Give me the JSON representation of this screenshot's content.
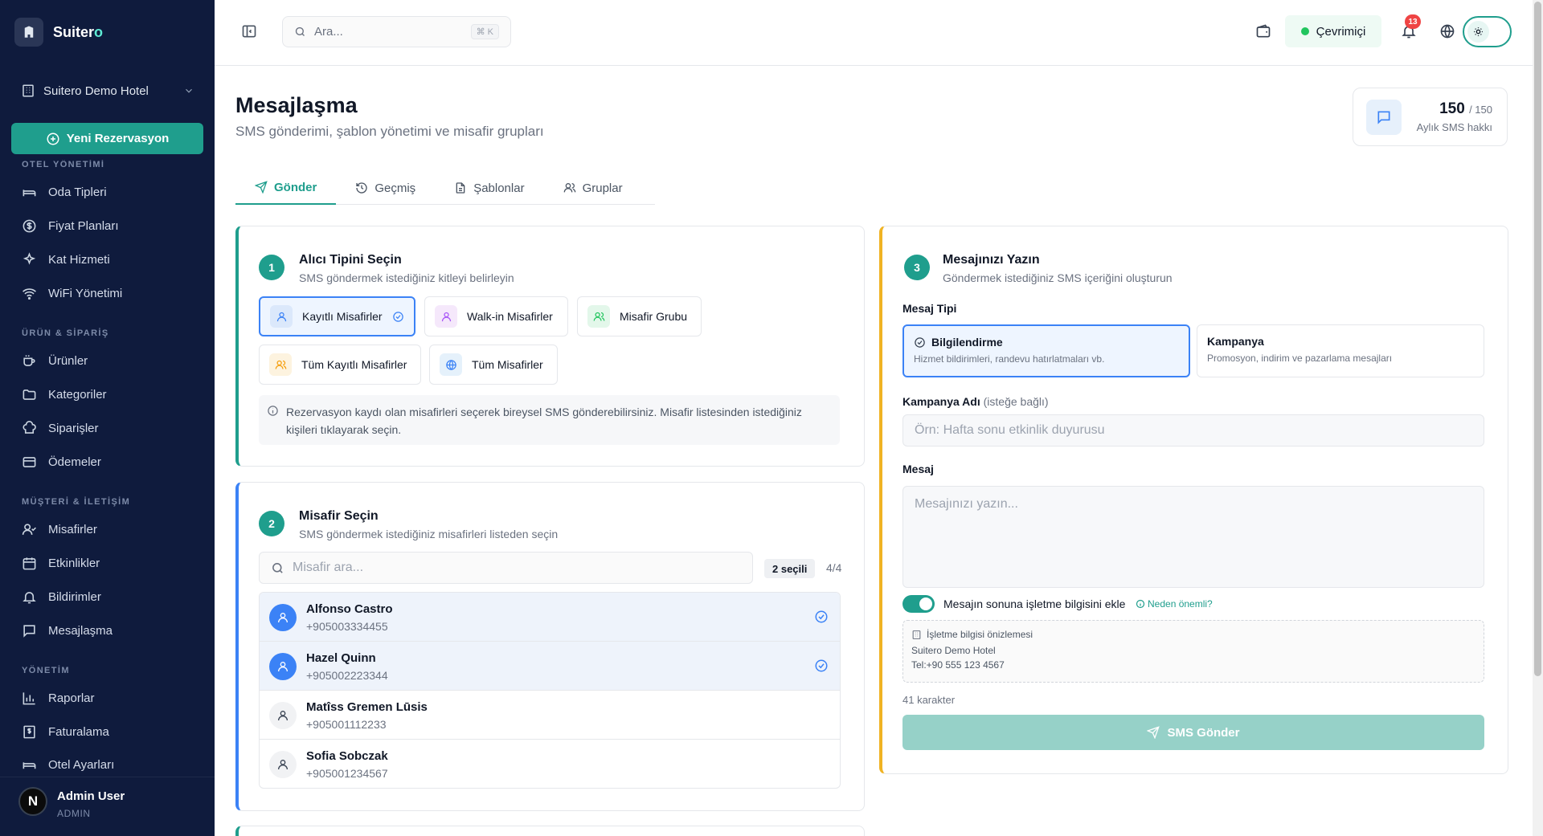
{
  "sidebar": {
    "brand_prefix": "Suiter",
    "brand_accent": "o",
    "hotel": "Suitero Demo Hotel",
    "new_reservation": "Yeni Rezervasyon",
    "sections": {
      "hotel": "OTEL YÖNETİMİ",
      "products": "ÜRÜN & SİPARİŞ",
      "customers": "MÜŞTERİ & İLETİŞİM",
      "admin": "YÖNETİM"
    },
    "items": {
      "room_types": "Oda Tipleri",
      "price_plans": "Fiyat Planları",
      "housekeeping": "Kat Hizmeti",
      "wifi": "WiFi Yönetimi",
      "products": "Ürünler",
      "categories": "Kategoriler",
      "orders": "Siparişler",
      "payments": "Ödemeler",
      "guests": "Misafirler",
      "events": "Etkinlikler",
      "notifications": "Bildirimler",
      "messaging": "Mesajlaşma",
      "reports": "Raporlar",
      "billing": "Faturalama",
      "hotel_settings": "Otel Ayarları"
    },
    "user": {
      "initial": "N",
      "name": "Admin User",
      "role": "ADMIN"
    }
  },
  "topbar": {
    "search_placeholder": "Ara...",
    "search_shortcut": "⌘ K",
    "status": "Çevrimiçi",
    "notification_count": "13"
  },
  "header": {
    "title": "Mesajlaşma",
    "subtitle": "SMS gönderimi, şablon yönetimi ve misafir grupları",
    "quota_used": "150",
    "quota_total": "/ 150",
    "quota_label": "Aylık SMS hakkı"
  },
  "tabs": {
    "send": "Gönder",
    "history": "Geçmiş",
    "templates": "Şablonlar",
    "groups": "Gruplar"
  },
  "step1": {
    "num": "1",
    "title": "Alıcı Tipini Seçin",
    "subtitle": "SMS göndermek istediğiniz kitleyi belirleyin",
    "options": {
      "registered": "Kayıtlı Misafirler",
      "walkin": "Walk-in Misafirler",
      "group": "Misafir Grubu",
      "all_registered": "Tüm Kayıtlı Misafirler",
      "all": "Tüm Misafirler"
    },
    "info": "Rezervasyon kaydı olan misafirleri seçerek bireysel SMS gönderebilirsiniz. Misafir listesinden istediğiniz kişileri tıklayarak seçin."
  },
  "step2": {
    "num": "2",
    "title": "Misafir Seçin",
    "subtitle": "SMS göndermek istediğiniz misafirleri listeden seçin",
    "search_placeholder": "Misafir ara...",
    "selected_count": "2 seçili",
    "total": "4/4",
    "guests": [
      {
        "name": "Alfonso Castro",
        "phone": "+905003334455",
        "selected": true
      },
      {
        "name": "Hazel Quinn",
        "phone": "+905002223344",
        "selected": true
      },
      {
        "name": "Matîss Gremen Lūsis",
        "phone": "+905001112233",
        "selected": false
      },
      {
        "name": "Sofia Sobczak",
        "phone": "+905001234567",
        "selected": false
      }
    ]
  },
  "step3": {
    "num": "3",
    "title": "Mesajınızı Yazın",
    "subtitle": "Göndermek istediğiniz SMS içeriğini oluşturun",
    "message_type_label": "Mesaj Tipi",
    "type_info": {
      "title": "Bilgilendirme",
      "desc": "Hizmet bildirimleri, randevu hatırlatmaları vb."
    },
    "type_campaign": {
      "title": "Kampanya",
      "desc": "Promosyon, indirim ve pazarlama mesajları"
    },
    "campaign_label": "Kampanya Adı",
    "campaign_optional": "(isteğe bağlı)",
    "campaign_placeholder": "Örn: Hafta sonu etkinlik duyurusu",
    "message_label": "Mesaj",
    "message_placeholder": "Mesajınızı yazın...",
    "append_label": "Mesajın sonuna işletme bilgisini ekle",
    "why_link": "Neden önemli?",
    "preview_title": "İşletme bilgisi önizlemesi",
    "preview_name": "Suitero Demo Hotel",
    "preview_tel": "Tel:+90 555 123 4567",
    "char_count": "41 karakter",
    "send_button": "SMS Gönder"
  },
  "colors": {
    "sidebar_bg": "#0f1b3d",
    "accent": "#1f9e8d",
    "selected_blue": "#3b82f6",
    "warning": "#f0b323"
  }
}
